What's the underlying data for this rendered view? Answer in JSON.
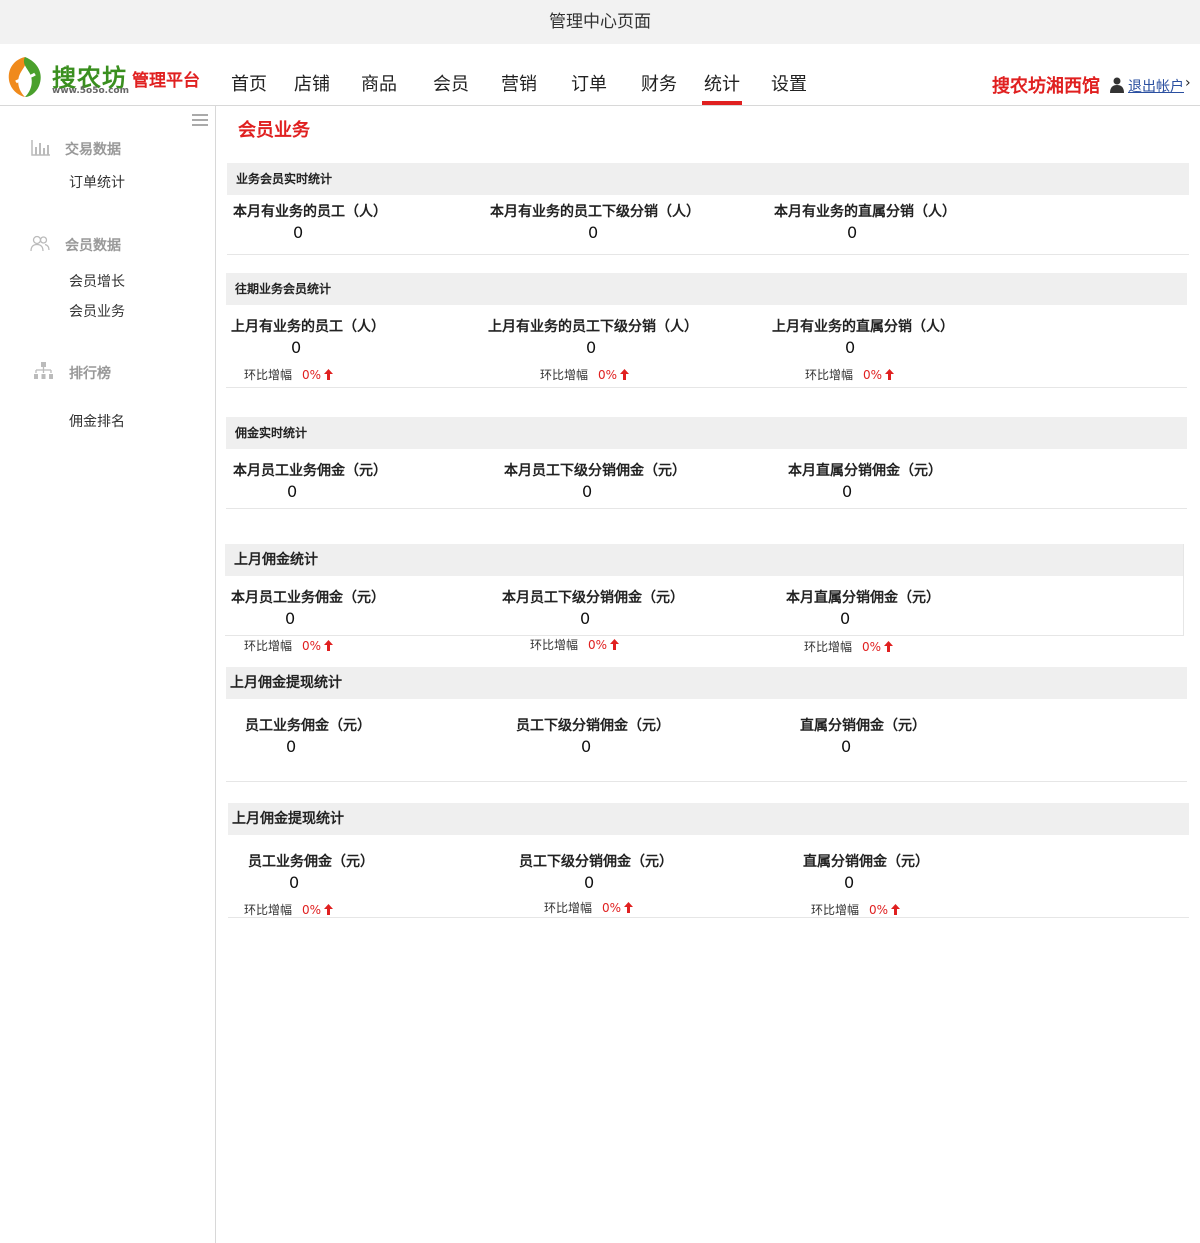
{
  "window": {
    "title": "管理中心页面"
  },
  "brand": {
    "name": "搜农坊",
    "url": "www.5o5o.com",
    "platform": "管理平台"
  },
  "nav": [
    {
      "label": "首页"
    },
    {
      "label": "店铺"
    },
    {
      "label": "商品"
    },
    {
      "label": "会员"
    },
    {
      "label": "营销"
    },
    {
      "label": "订单"
    },
    {
      "label": "财务"
    },
    {
      "label": "统计",
      "active": true
    },
    {
      "label": "设置"
    }
  ],
  "account": {
    "shop": "搜农坊湘西馆",
    "logout": "退出帐户"
  },
  "sidebar": {
    "groups": [
      {
        "title": "交易数据",
        "icon": "bar-chart-icon",
        "items": [
          "订单统计"
        ]
      },
      {
        "title": "会员数据",
        "icon": "users-icon",
        "items": [
          "会员增长",
          "会员业务"
        ]
      },
      {
        "title": "排行榜",
        "icon": "org-chart-icon",
        "items": [
          "佣金排名"
        ]
      }
    ]
  },
  "page": {
    "title": "会员业务"
  },
  "colors": {
    "accent": "#e02020",
    "brand_green": "#3a8f1f",
    "panel_head": "#efefef"
  },
  "panels": [
    {
      "title": "业务会员实时统计",
      "stats": [
        {
          "label": "本月有业务的员工（人）",
          "value": "0"
        },
        {
          "label": "本月有业务的员工下级分销（人）",
          "value": "0"
        },
        {
          "label": "本月有业务的直属分销（人）",
          "value": "0"
        }
      ]
    },
    {
      "title": "往期业务会员统计",
      "stats": [
        {
          "label": "上月有业务的员工（人）",
          "value": "0",
          "trend_label": "环比增幅",
          "trend_value": "0%"
        },
        {
          "label": "上月有业务的员工下级分销（人）",
          "value": "0",
          "trend_label": "环比增幅",
          "trend_value": "0%"
        },
        {
          "label": "上月有业务的直属分销（人）",
          "value": "0",
          "trend_label": "环比增幅",
          "trend_value": "0%"
        }
      ]
    },
    {
      "title": "佣金实时统计",
      "stats": [
        {
          "label": "本月员工业务佣金（元）",
          "value": "0"
        },
        {
          "label": "本月员工下级分销佣金（元）",
          "value": "0"
        },
        {
          "label": "本月直属分销佣金（元）",
          "value": "0"
        }
      ]
    },
    {
      "title": "上月佣金统计",
      "stats": [
        {
          "label": "本月员工业务佣金（元）",
          "value": "0",
          "trend_label": "环比增幅",
          "trend_value": "0%"
        },
        {
          "label": "本月员工下级分销佣金（元）",
          "value": "0",
          "trend_label": "环比增幅",
          "trend_value": "0%"
        },
        {
          "label": "本月直属分销佣金（元）",
          "value": "0",
          "trend_label": "环比增幅",
          "trend_value": "0%"
        }
      ]
    },
    {
      "title": "上月佣金提现统计",
      "stats": [
        {
          "label": "员工业务佣金（元）",
          "value": "0"
        },
        {
          "label": "员工下级分销佣金（元）",
          "value": "0"
        },
        {
          "label": "直属分销佣金（元）",
          "value": "0"
        }
      ]
    },
    {
      "title": "上月佣金提现统计",
      "stats": [
        {
          "label": "员工业务佣金（元）",
          "value": "0",
          "trend_label": "环比增幅",
          "trend_value": "0%"
        },
        {
          "label": "员工下级分销佣金（元）",
          "value": "0",
          "trend_label": "环比增幅",
          "trend_value": "0%"
        },
        {
          "label": "直属分销佣金（元）",
          "value": "0",
          "trend_label": "环比增幅",
          "trend_value": "0%"
        }
      ]
    }
  ]
}
